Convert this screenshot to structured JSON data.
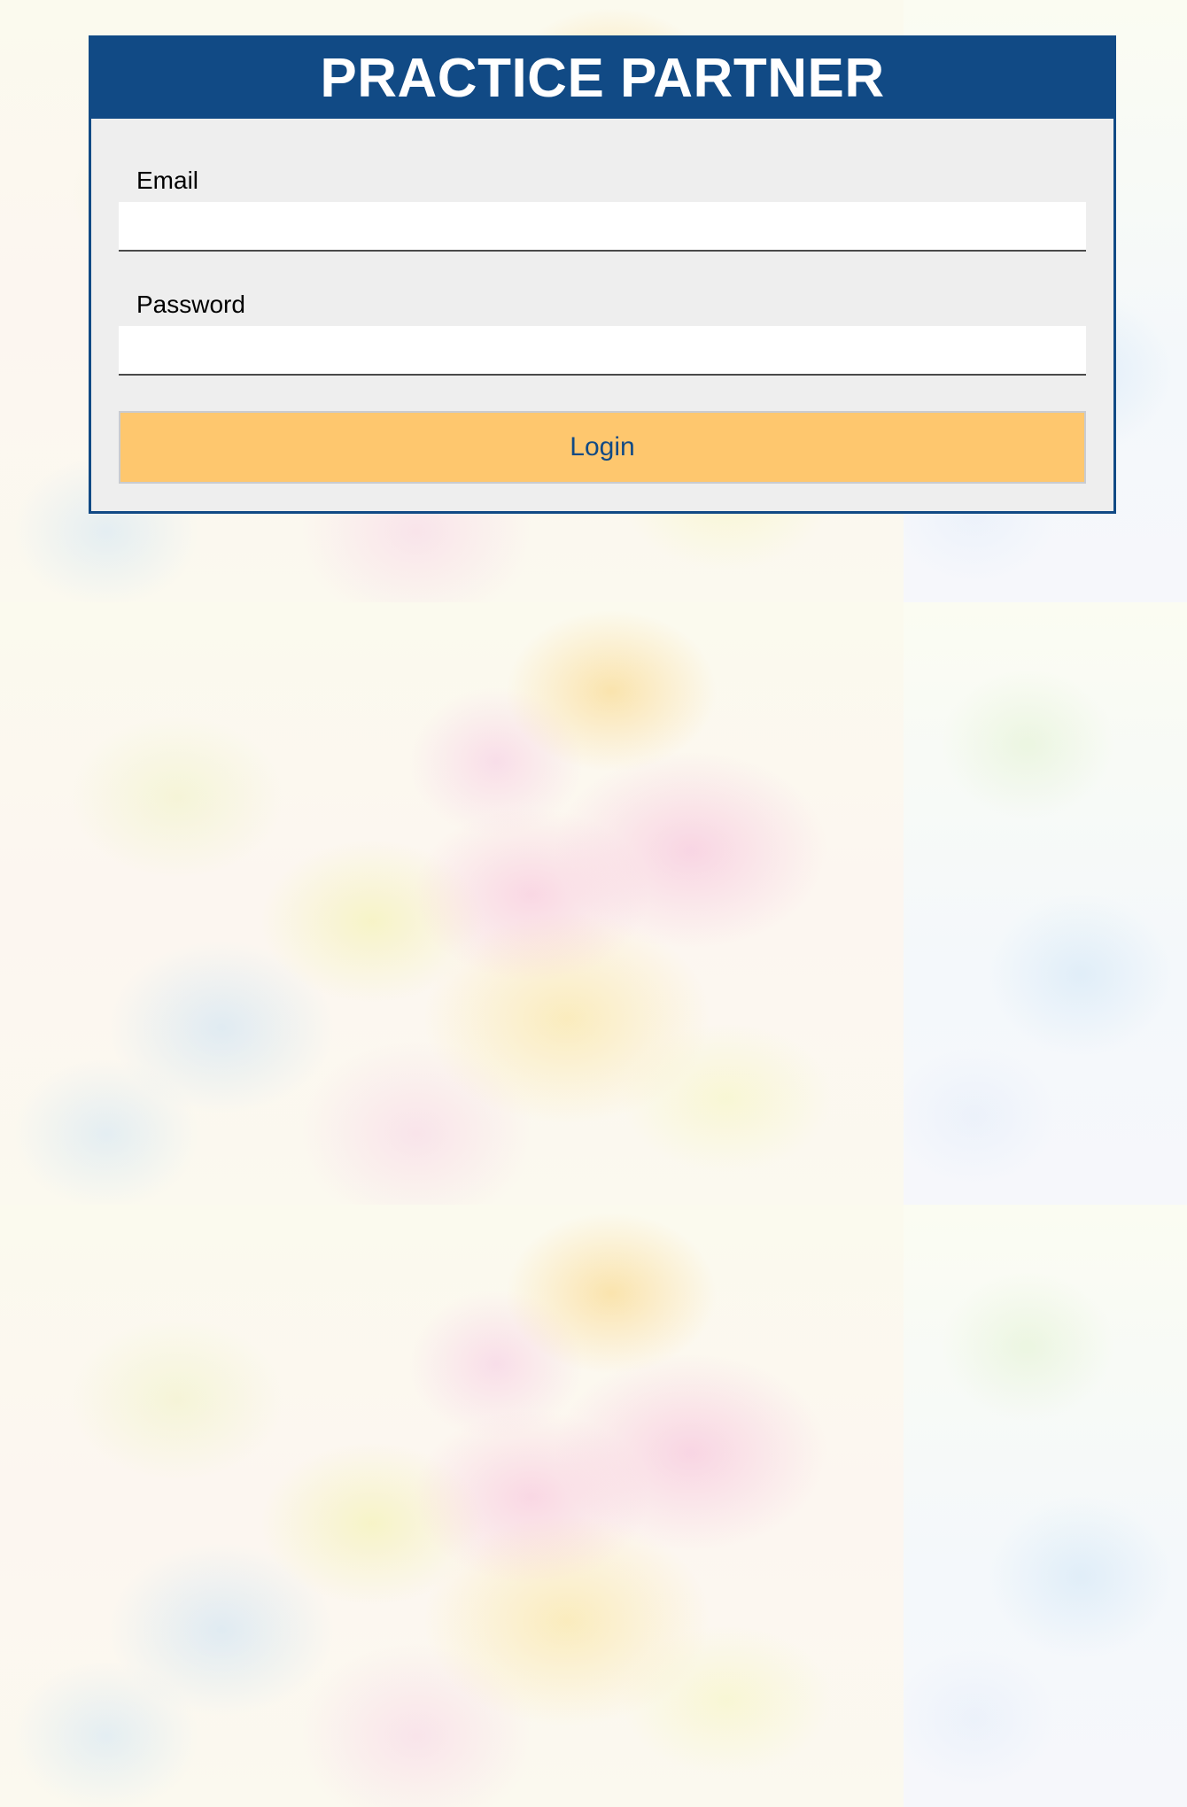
{
  "app": {
    "title": "PRACTICE PARTNER"
  },
  "login_form": {
    "email": {
      "label": "Email",
      "value": "",
      "placeholder": ""
    },
    "password": {
      "label": "Password",
      "value": "",
      "placeholder": ""
    },
    "submit_label": "Login"
  },
  "colors": {
    "brand_blue": "#114a85",
    "button_orange": "#fec76e",
    "panel_gray": "#eeeeee"
  }
}
